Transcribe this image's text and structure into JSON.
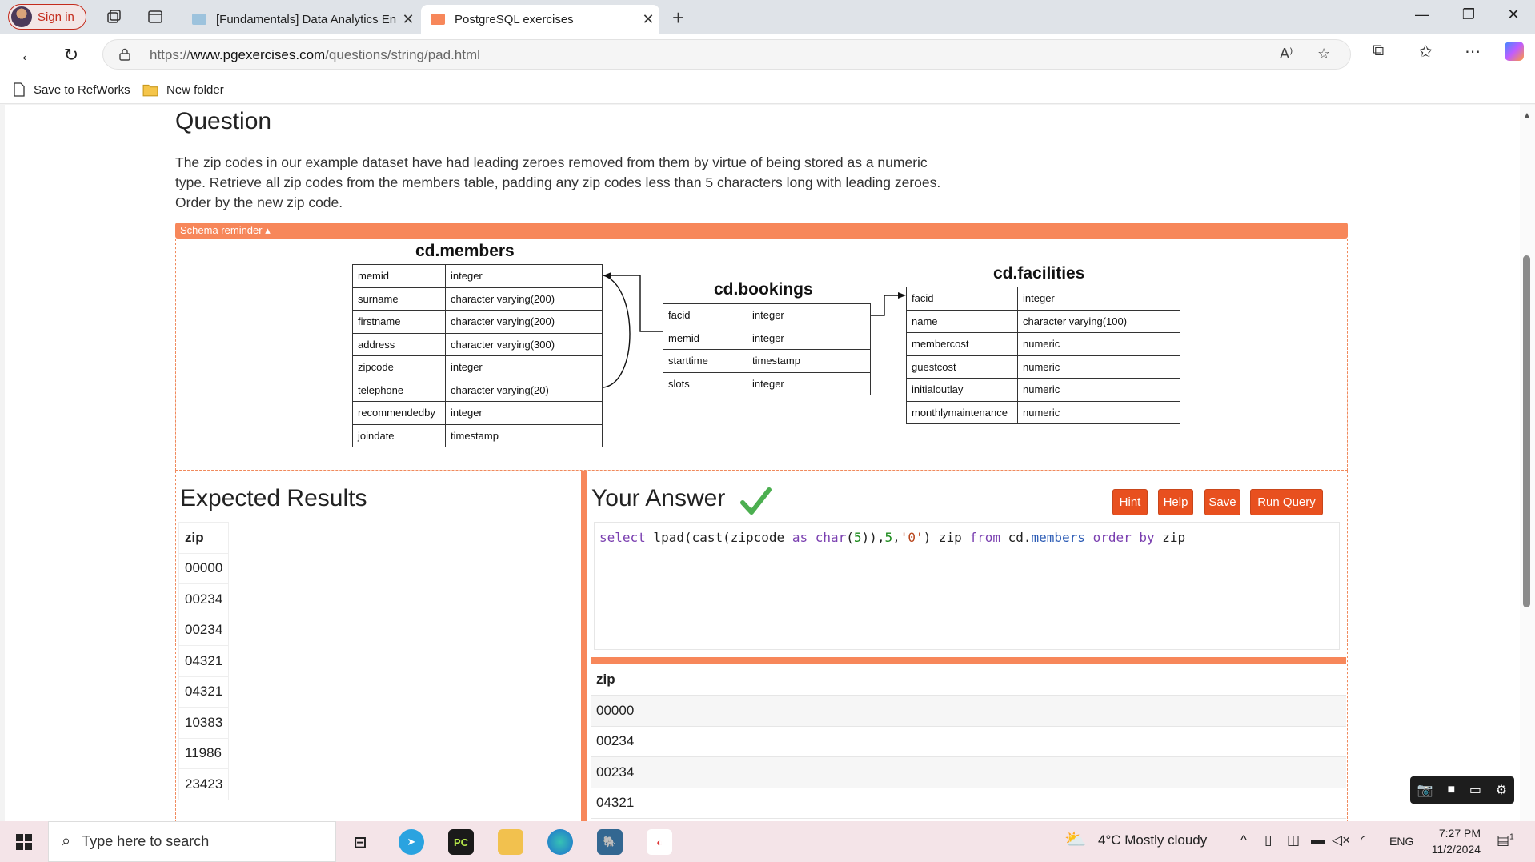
{
  "browser": {
    "signin_label": "Sign in",
    "tabs": [
      {
        "title": "[Fundamentals] Data Analytics En"
      },
      {
        "title": "PostgreSQL exercises"
      }
    ],
    "url_prefix": "https://",
    "url_domain": "www.pgexercises.com",
    "url_path": "/questions/string/pad.html",
    "favorites": [
      {
        "label": "Save to RefWorks"
      },
      {
        "label": "New folder"
      }
    ]
  },
  "question": {
    "title": "Question",
    "text": "The zip codes in our example dataset have had leading zeroes removed from them by virtue of being stored as a numeric type. Retrieve all zip codes from the members table, padding any zip codes less than 5 characters long with leading zeroes. Order by the new zip code."
  },
  "schema": {
    "toggle_label": "Schema reminder ▴",
    "members": {
      "title": "cd.members",
      "rows": [
        [
          "memid",
          "integer"
        ],
        [
          "surname",
          "character varying(200)"
        ],
        [
          "firstname",
          "character varying(200)"
        ],
        [
          "address",
          "character varying(300)"
        ],
        [
          "zipcode",
          "integer"
        ],
        [
          "telephone",
          "character varying(20)"
        ],
        [
          "recommendedby",
          "integer"
        ],
        [
          "joindate",
          "timestamp"
        ]
      ]
    },
    "bookings": {
      "title": "cd.bookings",
      "rows": [
        [
          "facid",
          "integer"
        ],
        [
          "memid",
          "integer"
        ],
        [
          "starttime",
          "timestamp"
        ],
        [
          "slots",
          "integer"
        ]
      ]
    },
    "facilities": {
      "title": "cd.facilities",
      "rows": [
        [
          "facid",
          "integer"
        ],
        [
          "name",
          "character varying(100)"
        ],
        [
          "membercost",
          "numeric"
        ],
        [
          "guestcost",
          "numeric"
        ],
        [
          "initialoutlay",
          "numeric"
        ],
        [
          "monthlymaintenance",
          "numeric"
        ]
      ]
    }
  },
  "expected": {
    "title": "Expected Results",
    "header": "zip",
    "rows": [
      "00000",
      "00234",
      "00234",
      "04321",
      "04321",
      "10383",
      "11986",
      "23423"
    ]
  },
  "answer": {
    "title": "Your Answer",
    "buttons": {
      "hint": "Hint",
      "help": "Help",
      "save": "Save",
      "run": "Run Query"
    },
    "query_tokens": {
      "select": "select",
      "lpad": " lpad(cast(zipcode ",
      "as": "as",
      "char": " char",
      "open": "(",
      "five1": "5",
      "mid": ")),",
      "five2": "5",
      "comma": ",",
      "zero": "'0'",
      "close": ") zip ",
      "from": "from",
      "cd": " cd.",
      "members": "members",
      "order": " order",
      "by": " by",
      "zip": " zip"
    },
    "result_header": "zip",
    "result_rows": [
      "00000",
      "00234",
      "00234",
      "04321"
    ]
  },
  "taskbar": {
    "search_placeholder": "Type here to search",
    "weather": "4°C  Mostly cloudy",
    "lang": "ENG",
    "time": "7:27 PM",
    "date": "11/2/2024",
    "notifications": "1"
  }
}
